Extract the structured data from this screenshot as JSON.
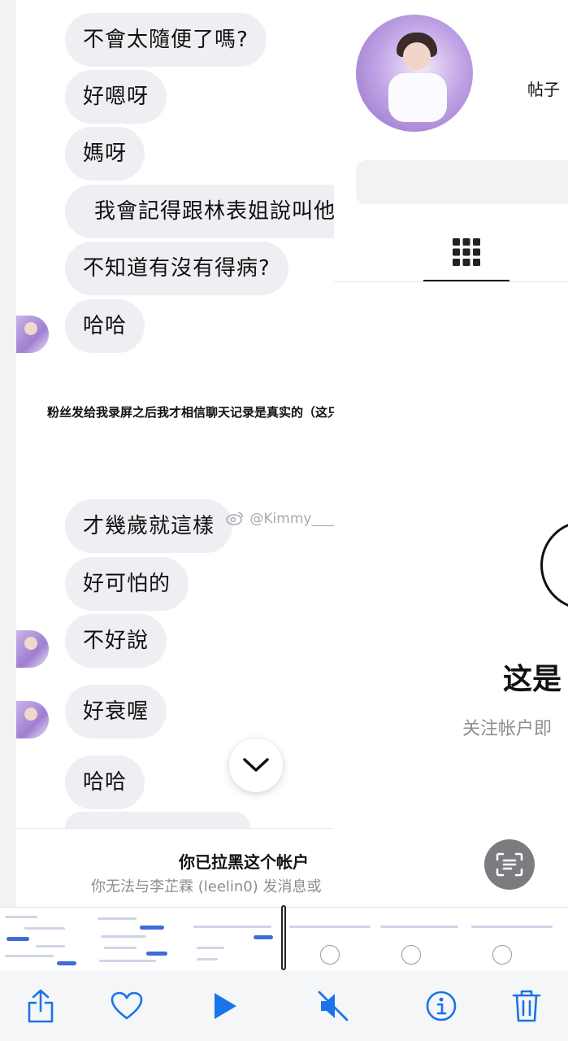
{
  "chat": {
    "messages": [
      {
        "text": "不會太隨便了嗎?"
      },
      {
        "text": "好嗯呀"
      },
      {
        "text": "媽呀"
      },
      {
        "text": "我會記得跟林表姐說叫他"
      },
      {
        "text": "不知道有沒有得病?"
      },
      {
        "text": "哈哈"
      },
      {
        "text": "才幾歲就這樣"
      },
      {
        "text": "好可怕的"
      },
      {
        "text": "不好說"
      },
      {
        "text": "好衰喔"
      },
      {
        "text": "哈哈"
      }
    ],
    "caption": "粉丝发给我录屏之后我才相信聊天记录是真实的（这只是一部分）",
    "watermark": "@Kimmy____",
    "blocked_title": "你已拉黑这个帐户",
    "blocked_sub": "你无法与李芷霖 (leelin0) 发消息或"
  },
  "profile": {
    "posts_label": "帖子",
    "private_title": "这是",
    "private_sub": "关注帐户即"
  },
  "toolbar": {
    "icons": [
      "share-icon",
      "heart-icon",
      "play-icon",
      "mute-icon",
      "info-icon",
      "trash-icon"
    ],
    "accent": "#1a73e8"
  }
}
